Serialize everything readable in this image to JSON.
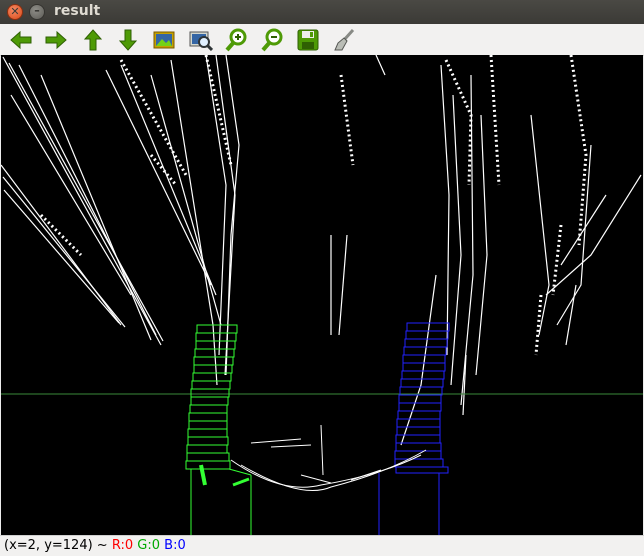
{
  "window": {
    "title": "result"
  },
  "toolbar": {
    "buttons": [
      {
        "name": "pan-left-button",
        "icon": "arrow-left-icon"
      },
      {
        "name": "pan-right-button",
        "icon": "arrow-right-icon"
      },
      {
        "name": "pan-up-button",
        "icon": "arrow-up-icon"
      },
      {
        "name": "pan-down-button",
        "icon": "arrow-down-icon"
      },
      {
        "name": "zoom-fit-button",
        "icon": "image-icon"
      },
      {
        "name": "zoom-region-button",
        "icon": "zoom-region-icon"
      },
      {
        "name": "zoom-in-button",
        "icon": "zoom-in-icon"
      },
      {
        "name": "zoom-out-button",
        "icon": "zoom-out-icon"
      },
      {
        "name": "save-button",
        "icon": "floppy-disk-icon"
      },
      {
        "name": "properties-button",
        "icon": "brush-icon"
      }
    ]
  },
  "status": {
    "coords": "(x=2, y=124) ~",
    "r": "R:0",
    "g": "G:0",
    "b": "B:0"
  },
  "colors": {
    "left_box": "#33ff33",
    "right_box": "#2222ff",
    "horizon": "#3a8a3a",
    "background": "#000000"
  }
}
